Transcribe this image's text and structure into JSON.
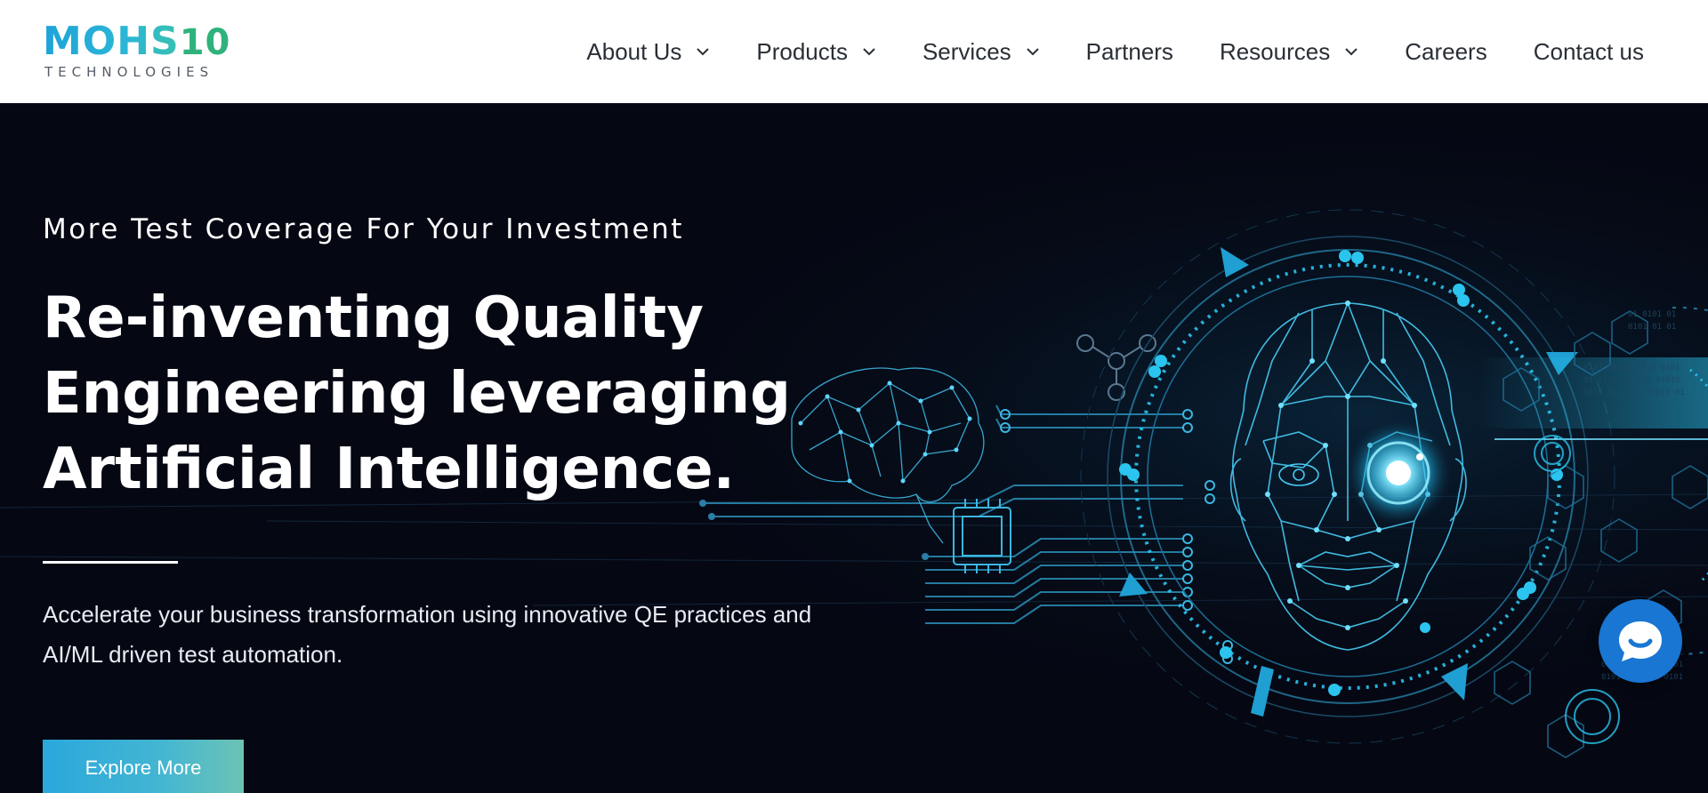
{
  "brand": {
    "logo_main": "MOHS",
    "logo_num": "10",
    "logo_sub": "TECHNOLOGIES"
  },
  "nav": {
    "items": [
      {
        "label": "About Us",
        "has_dropdown": true
      },
      {
        "label": "Products",
        "has_dropdown": true
      },
      {
        "label": "Services",
        "has_dropdown": true
      },
      {
        "label": "Partners",
        "has_dropdown": false
      },
      {
        "label": "Resources",
        "has_dropdown": true
      },
      {
        "label": "Careers",
        "has_dropdown": false
      },
      {
        "label": "Contact us",
        "has_dropdown": false
      }
    ]
  },
  "hero": {
    "eyebrow": "More Test Coverage For Your Investment",
    "headline_lines": [
      "Re-inventing Quality",
      "Engineering leveraging",
      "Artificial Intelligence."
    ],
    "description_lines": [
      "Accelerate your business transformation using innovative QE practices and",
      "AI/ML driven test automation."
    ],
    "cta_label": "Explore More",
    "illustration_icon": "ai-face-circuit-illustration"
  },
  "chat": {
    "icon": "chat-bubble-icon"
  },
  "colors": {
    "hero_bg": "#050813",
    "accent_cyan": "#2bc4ee",
    "cta_start": "#2aa8dc",
    "cta_end": "#6cc3b4",
    "chat_blue": "#1976d2",
    "nav_text": "#2a2f36"
  }
}
